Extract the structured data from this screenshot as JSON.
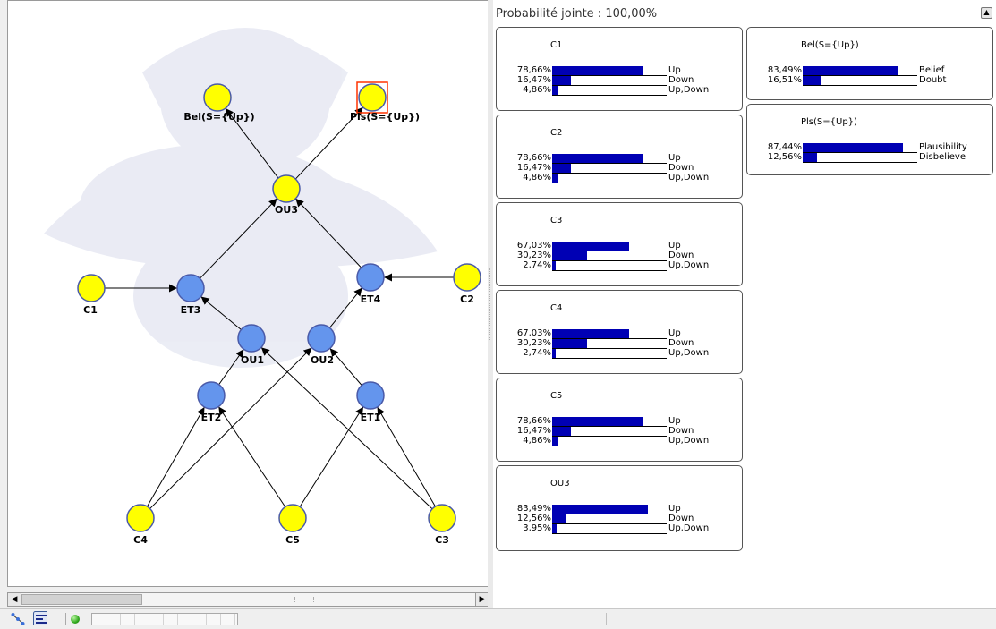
{
  "header": {
    "joint_probability": "Probabilité jointe : 100,00%"
  },
  "graph": {
    "nodes": [
      {
        "id": "bel",
        "label": "Bel(S={Up})",
        "color": "yellow",
        "selected": false
      },
      {
        "id": "pls",
        "label": "Pls(S={Up})",
        "color": "yellow",
        "selected": true
      },
      {
        "id": "ou3",
        "label": "OU3",
        "color": "yellow",
        "selected": false
      },
      {
        "id": "c1",
        "label": "C1",
        "color": "yellow",
        "selected": false
      },
      {
        "id": "et3",
        "label": "ET3",
        "color": "blue",
        "selected": false
      },
      {
        "id": "et4",
        "label": "ET4",
        "color": "blue",
        "selected": false
      },
      {
        "id": "c2",
        "label": "C2",
        "color": "yellow",
        "selected": false
      },
      {
        "id": "ou1",
        "label": "OU1",
        "color": "blue",
        "selected": false
      },
      {
        "id": "ou2",
        "label": "OU2",
        "color": "blue",
        "selected": false
      },
      {
        "id": "et2",
        "label": "ET2",
        "color": "blue",
        "selected": false
      },
      {
        "id": "et1",
        "label": "ET1",
        "color": "blue",
        "selected": false
      },
      {
        "id": "c4",
        "label": "C4",
        "color": "yellow",
        "selected": false
      },
      {
        "id": "c5",
        "label": "C5",
        "color": "yellow",
        "selected": false
      },
      {
        "id": "c3",
        "label": "C3",
        "color": "yellow",
        "selected": false
      }
    ],
    "edges": [
      [
        "ou3",
        "bel"
      ],
      [
        "ou3",
        "pls"
      ],
      [
        "et3",
        "ou3"
      ],
      [
        "et4",
        "ou3"
      ],
      [
        "c1",
        "et3"
      ],
      [
        "c2",
        "et4"
      ],
      [
        "ou1",
        "et3"
      ],
      [
        "ou2",
        "et4"
      ],
      [
        "et2",
        "ou1"
      ],
      [
        "et1",
        "ou2"
      ],
      [
        "c4",
        "et2"
      ],
      [
        "c4",
        "ou2"
      ],
      [
        "c5",
        "et2"
      ],
      [
        "c5",
        "et1"
      ],
      [
        "c3",
        "et1"
      ],
      [
        "c3",
        "ou1"
      ]
    ]
  },
  "monitors": [
    {
      "title": "C1",
      "rows": [
        {
          "pct": "78,66%",
          "value": 0.7866,
          "state": "Up"
        },
        {
          "pct": "16,47%",
          "value": 0.1647,
          "state": "Down"
        },
        {
          "pct": "4,86%",
          "value": 0.0486,
          "state": "Up,Down"
        }
      ]
    },
    {
      "title": "C2",
      "rows": [
        {
          "pct": "78,66%",
          "value": 0.7866,
          "state": "Up"
        },
        {
          "pct": "16,47%",
          "value": 0.1647,
          "state": "Down"
        },
        {
          "pct": "4,86%",
          "value": 0.0486,
          "state": "Up,Down"
        }
      ]
    },
    {
      "title": "C3",
      "rows": [
        {
          "pct": "67,03%",
          "value": 0.6703,
          "state": "Up"
        },
        {
          "pct": "30,23%",
          "value": 0.3023,
          "state": "Down"
        },
        {
          "pct": "2,74%",
          "value": 0.0274,
          "state": "Up,Down"
        }
      ]
    },
    {
      "title": "C4",
      "rows": [
        {
          "pct": "67,03%",
          "value": 0.6703,
          "state": "Up"
        },
        {
          "pct": "30,23%",
          "value": 0.3023,
          "state": "Down"
        },
        {
          "pct": "2,74%",
          "value": 0.0274,
          "state": "Up,Down"
        }
      ]
    },
    {
      "title": "C5",
      "rows": [
        {
          "pct": "78,66%",
          "value": 0.7866,
          "state": "Up"
        },
        {
          "pct": "16,47%",
          "value": 0.1647,
          "state": "Down"
        },
        {
          "pct": "4,86%",
          "value": 0.0486,
          "state": "Up,Down"
        }
      ]
    },
    {
      "title": "OU3",
      "rows": [
        {
          "pct": "83,49%",
          "value": 0.8349,
          "state": "Up"
        },
        {
          "pct": "12,56%",
          "value": 0.1256,
          "state": "Down"
        },
        {
          "pct": "3,95%",
          "value": 0.0395,
          "state": "Up,Down"
        }
      ]
    },
    {
      "title": "Bel(S={Up})",
      "rows": [
        {
          "pct": "83,49%",
          "value": 0.8349,
          "state": "Belief"
        },
        {
          "pct": "16,51%",
          "value": 0.1651,
          "state": "Doubt"
        }
      ]
    },
    {
      "title": "Pls(S={Up})",
      "rows": [
        {
          "pct": "87,44%",
          "value": 0.8744,
          "state": "Plausibility"
        },
        {
          "pct": "12,56%",
          "value": 0.1256,
          "state": "Disbelieve"
        }
      ]
    }
  ],
  "colors": {
    "yellow_node": "#ffff00",
    "blue_node": "#6495ed",
    "node_stroke": "#4a5aa8",
    "bar": "#0000b4",
    "selection": "#ff3300"
  },
  "statusbar": {
    "icons": [
      "network-view-icon",
      "monitor-view-icon"
    ],
    "status_led": "green"
  }
}
